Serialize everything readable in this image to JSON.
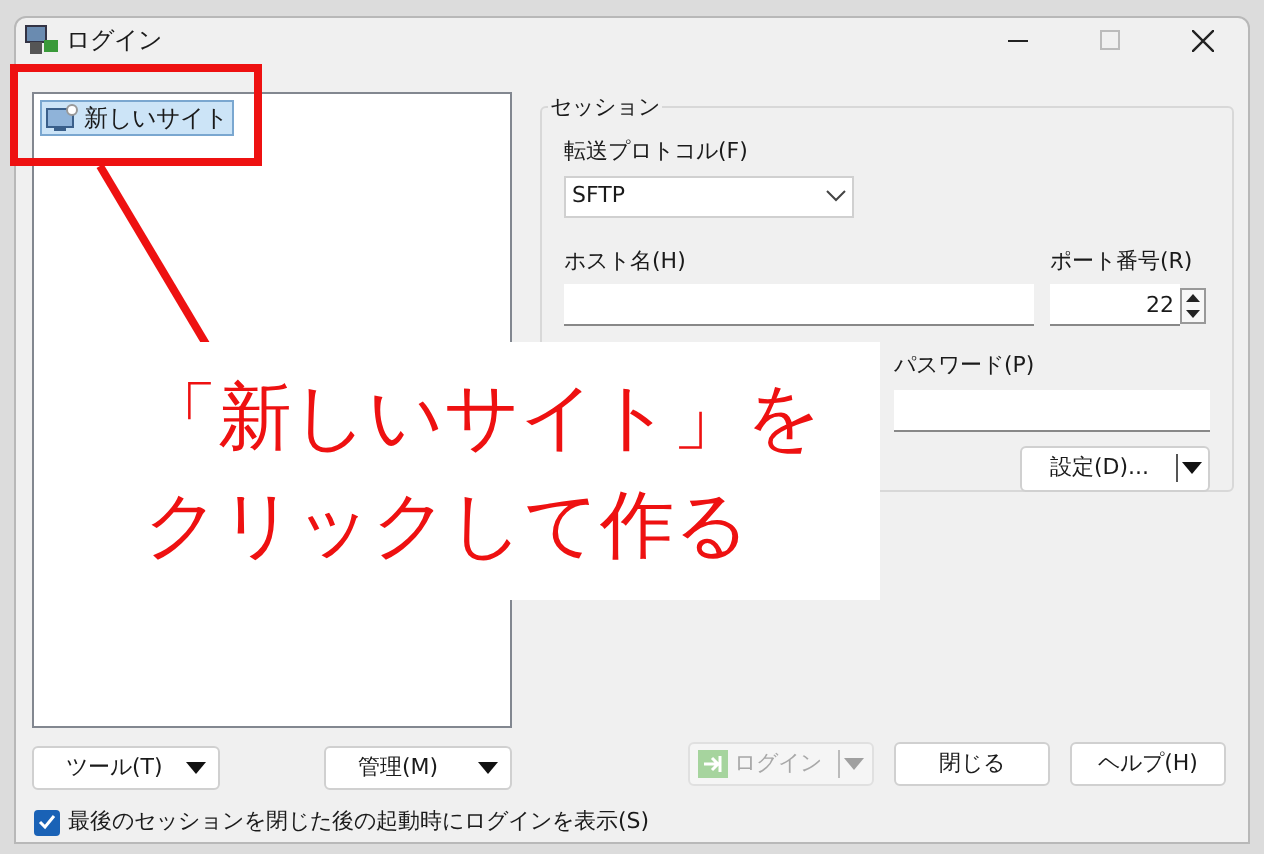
{
  "window": {
    "title": "ログイン"
  },
  "site_tree": {
    "items": [
      {
        "label": "新しいサイト",
        "selected": true
      }
    ]
  },
  "session": {
    "title": "セッション",
    "protocol": {
      "label": "転送プロトコル(F)",
      "value": "SFTP"
    },
    "host": {
      "label": "ホスト名(H)"
    },
    "port": {
      "label": "ポート番号(R)",
      "value": "22"
    },
    "password": {
      "label": "パスワード(P)"
    },
    "settings_button": "設定(D)..."
  },
  "left_buttons": [
    "ツール(T)",
    "管理(M)"
  ],
  "right_buttons": [
    {
      "label": "ログイン",
      "kind": "split",
      "disabled": true
    },
    {
      "label": "閉じる",
      "kind": "plain",
      "disabled": false
    },
    {
      "label": "ヘルプ(H)",
      "kind": "plain",
      "disabled": false
    }
  ],
  "startup_checkbox": {
    "label": "最後のセッションを閉じた後の起動時にログインを表示(S)",
    "checked": true
  },
  "annotation": {
    "lines": [
      "「新しいサイト」を",
      "クリックして作る"
    ]
  }
}
